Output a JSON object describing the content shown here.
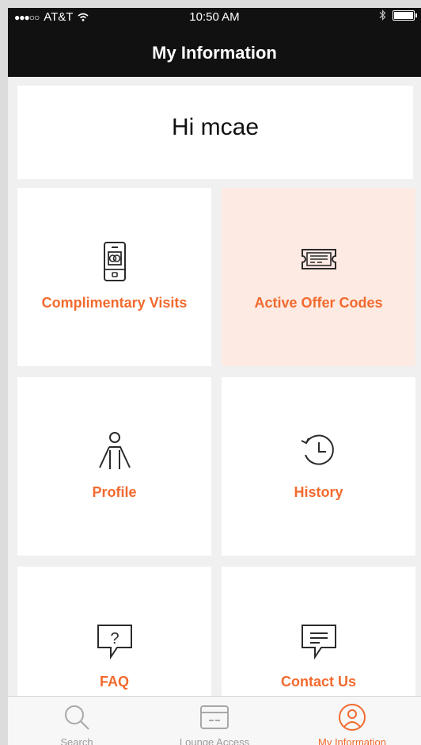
{
  "status_bar": {
    "carrier": "AT&T",
    "time": "10:50 AM",
    "signal_icon": "signal-dots-icon",
    "wifi_icon": "wifi-icon",
    "bluetooth_icon": "bluetooth-icon",
    "battery_icon": "battery-icon"
  },
  "header": {
    "title": "My Information"
  },
  "greeting": {
    "text": "Hi mcae"
  },
  "tiles": [
    {
      "label": "Complimentary Visits",
      "icon": "phone-card-icon"
    },
    {
      "label": "Active Offer Codes",
      "icon": "ticket-icon",
      "active": true
    },
    {
      "label": "Profile",
      "icon": "person-icon"
    },
    {
      "label": "History",
      "icon": "history-clock-icon"
    },
    {
      "label": "FAQ",
      "icon": "question-bubble-icon"
    },
    {
      "label": "Contact Us",
      "icon": "message-bubble-icon"
    }
  ],
  "tab_bar": {
    "tabs": [
      {
        "label": "Search",
        "icon": "search-icon"
      },
      {
        "label": "Lounge Access",
        "icon": "card-icon"
      },
      {
        "label": "My Information",
        "icon": "user-circle-icon",
        "selected": true
      }
    ]
  },
  "colors": {
    "accent": "#f26a2e",
    "active_tile_bg": "#fdeae3",
    "header_bg": "#111111",
    "inactive_tab": "#9a9a9a"
  }
}
